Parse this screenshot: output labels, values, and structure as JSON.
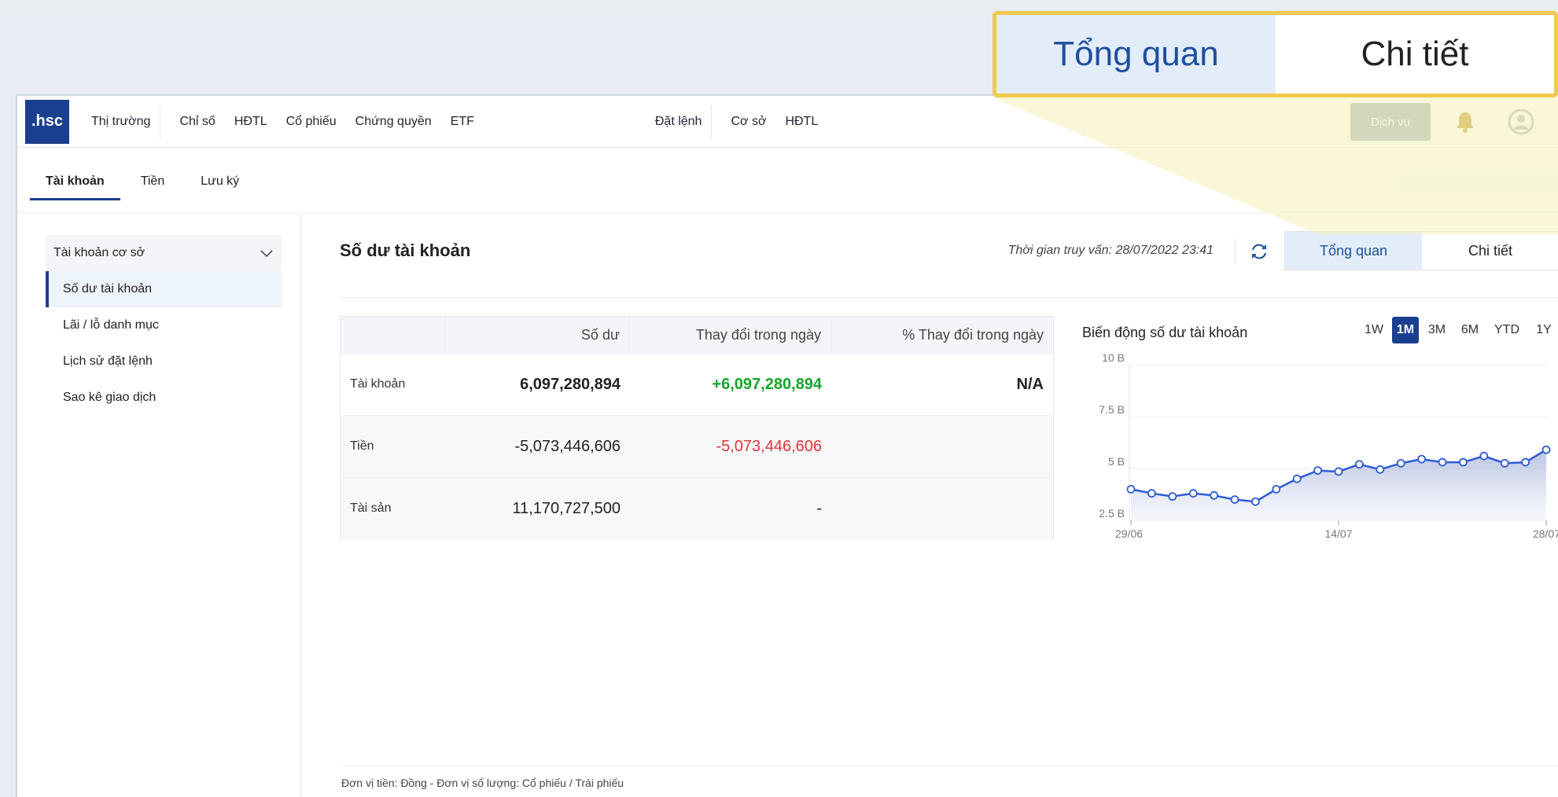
{
  "nav": {
    "logo": ".hsc",
    "items": [
      "Thị trường",
      "Chỉ số",
      "HĐTL",
      "Cổ phiếu",
      "Chứng quyền",
      "ETF"
    ],
    "order_items": [
      "Đặt lệnh",
      "Cơ sở",
      "HĐTL"
    ],
    "service_button": "Dịch vụ",
    "icons": [
      "bell-icon",
      "user-icon"
    ]
  },
  "subtabs": [
    "Tài khoản",
    "Tiền",
    "Lưu ký"
  ],
  "sidebar": {
    "group": "Tài khoản cơ sở",
    "items": [
      "Số dư tài khoản",
      "Lãi / lỗ danh mục",
      "Lịch sử đặt lệnh",
      "Sao kê giao dịch"
    ]
  },
  "main": {
    "title": "Số dư tài khoản",
    "query_time": "Thời gian truy vấn: 28/07/2022 23:41",
    "view_options": [
      "Tổng quan",
      "Chi tiết"
    ],
    "table": {
      "headers": [
        "",
        "Số dư",
        "Thay đổi trong ngày",
        "% Thay đổi trong ngày"
      ],
      "rows": [
        {
          "label": "Tài khoản",
          "balance": "6,097,280,894",
          "change": "+6,097,280,894",
          "pct": "N/A"
        },
        {
          "label": "Tiền",
          "balance": "-5,073,446,606",
          "change": "-5,073,446,606",
          "pct": ""
        },
        {
          "label": "Tài sản",
          "balance": "11,170,727,500",
          "change": "-",
          "pct": ""
        }
      ]
    },
    "chart_title": "Biến động số dư tài khoản",
    "ranges": [
      "1W",
      "1M",
      "3M",
      "6M",
      "YTD",
      "1Y"
    ],
    "footnote": "Đơn vị tiền: Đồng - Đơn vị số lượng: Cổ phiếu / Trái phiếu"
  },
  "callout": {
    "options": [
      "Tổng quan",
      "Chi tiết"
    ]
  },
  "colors": {
    "brand": "#1b3f8f",
    "positive": "#15a52a",
    "negative": "#e0353a",
    "highlight": "#f2c94c"
  },
  "chart_data": {
    "type": "area",
    "title": "Biến động số dư tài khoản",
    "xlabel": "",
    "ylabel": "",
    "x_tick_labels": [
      "29/06",
      "14/07",
      "28/07"
    ],
    "y_tick_labels": [
      "10 B",
      "7.5 B",
      "5 B",
      "2.5 B"
    ],
    "ylim": [
      2.5,
      10
    ],
    "series": [
      {
        "values": [
          4.0,
          3.8,
          3.65,
          3.8,
          3.7,
          3.5,
          3.4,
          4.0,
          4.5,
          4.9,
          4.85,
          5.2,
          4.95,
          5.25,
          5.45,
          5.3,
          5.3,
          5.6,
          5.25,
          5.3,
          5.9
        ]
      }
    ]
  }
}
